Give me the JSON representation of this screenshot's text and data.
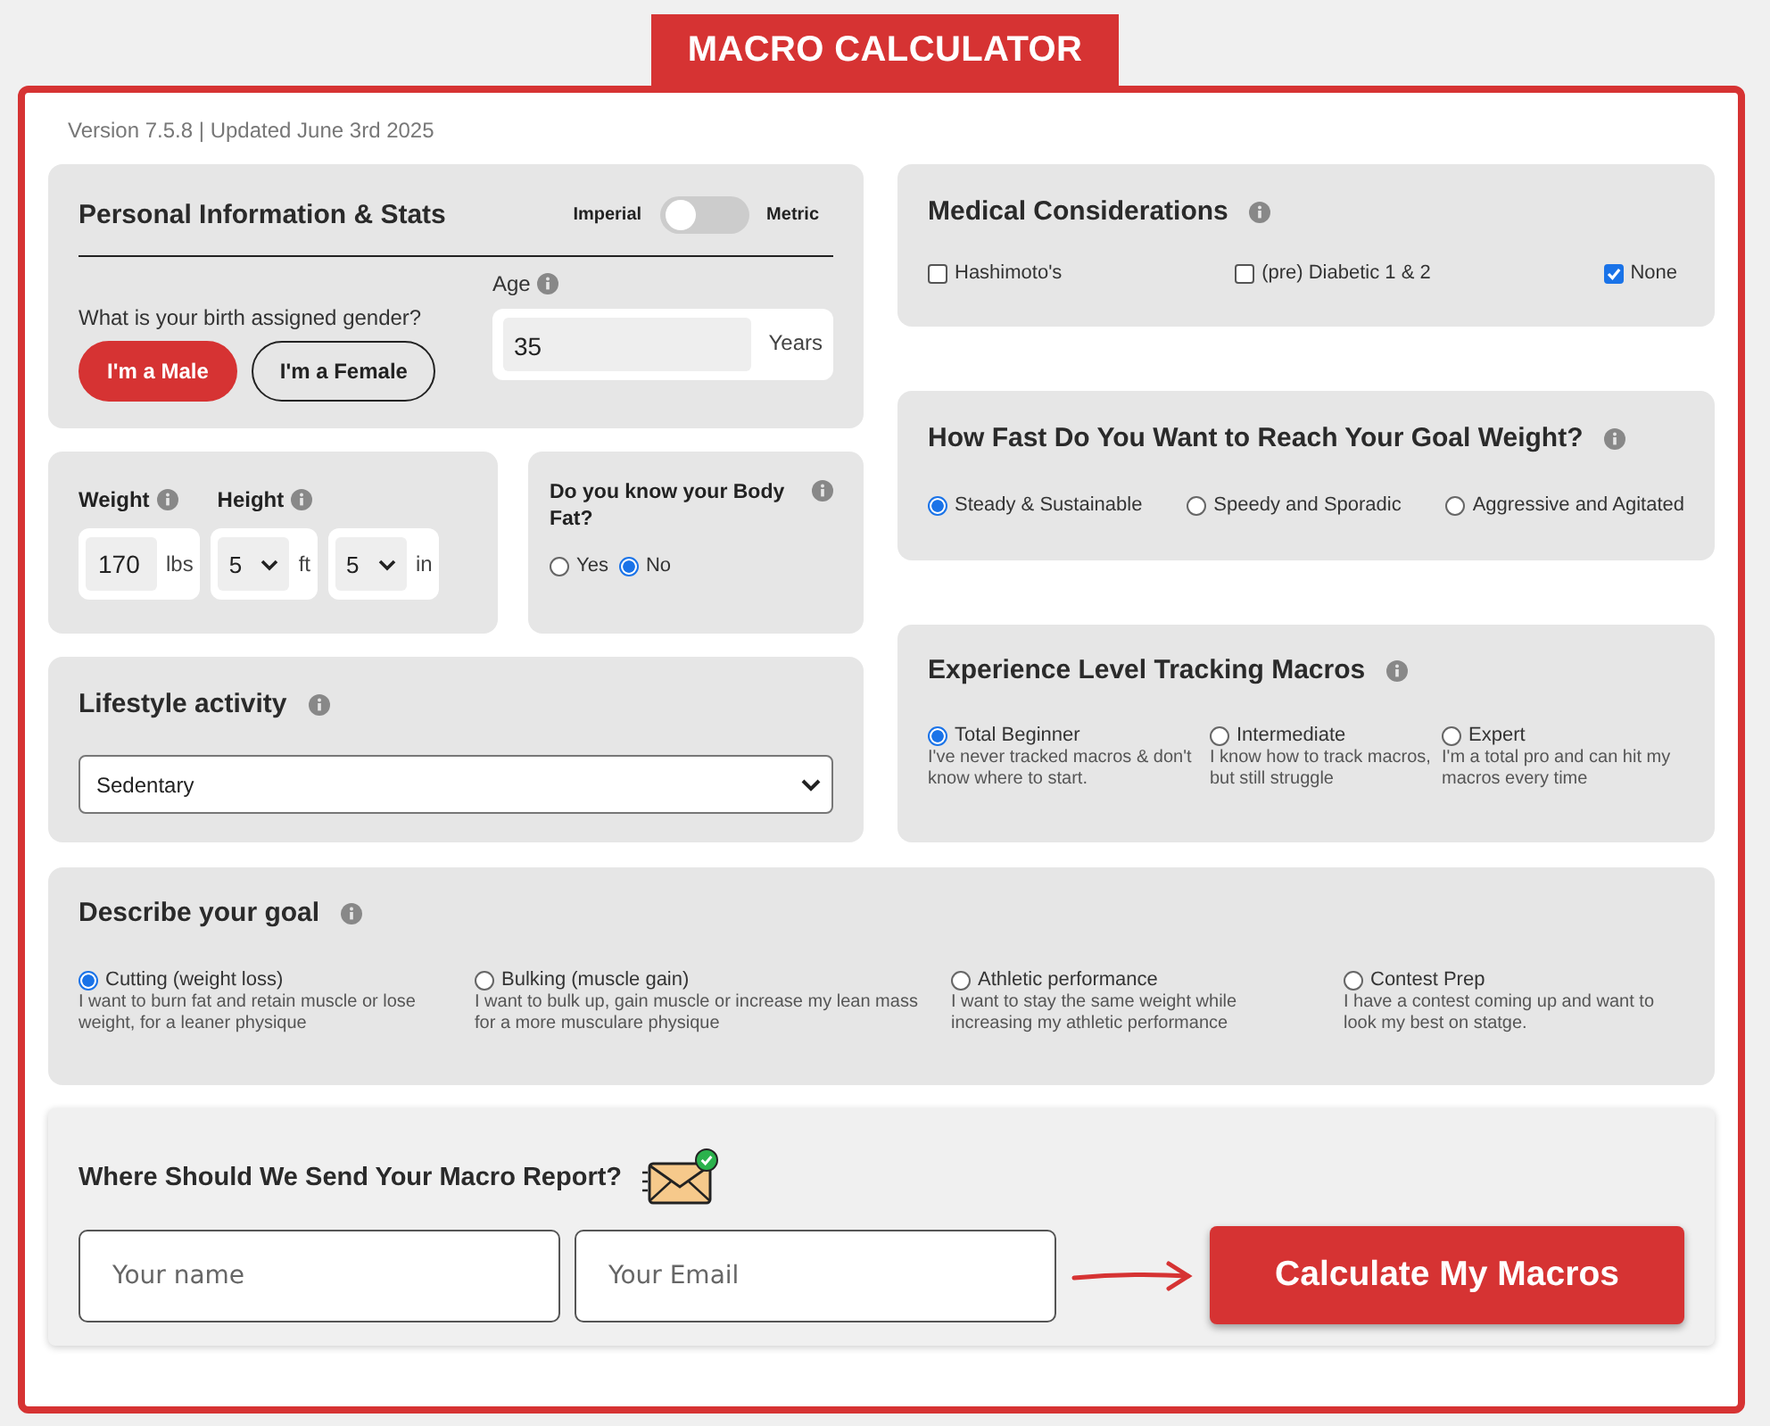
{
  "header": {
    "title": "MACRO CALCULATOR"
  },
  "version": "Version 7.5.8 | Updated June 3rd 2025",
  "personal": {
    "title": "Personal Information & Stats",
    "unit_toggle": {
      "left": "Imperial",
      "right": "Metric",
      "on": false
    },
    "gender": {
      "question": "What is your birth assigned gender?",
      "options": [
        {
          "label": "I'm a Male",
          "selected": true
        },
        {
          "label": "I'm a Female",
          "selected": false
        }
      ]
    },
    "age": {
      "label": "Age",
      "value": "35",
      "unit": "Years"
    }
  },
  "measurements": {
    "weight_label": "Weight",
    "height_label": "Height",
    "fields": [
      {
        "kind": "input",
        "value": "170",
        "unit": "lbs"
      },
      {
        "kind": "select",
        "value": "5",
        "unit": "ft"
      },
      {
        "kind": "select",
        "value": "5",
        "unit": "in"
      }
    ]
  },
  "body_fat": {
    "question": "Do you know your Body Fat?",
    "options": [
      {
        "label": "Yes",
        "selected": false
      },
      {
        "label": "No",
        "selected": true
      }
    ]
  },
  "lifestyle": {
    "title": "Lifestyle activity",
    "value": "Sedentary"
  },
  "medical": {
    "title": "Medical Considerations",
    "options": [
      {
        "label": "Hashimoto's",
        "checked": false
      },
      {
        "label": "(pre) Diabetic 1 & 2",
        "checked": false
      },
      {
        "label": "None",
        "checked": true
      }
    ]
  },
  "speed": {
    "title": "How Fast Do You Want to Reach Your Goal Weight?",
    "options": [
      {
        "label": "Steady & Sustainable",
        "selected": true
      },
      {
        "label": "Speedy and Sporadic",
        "selected": false
      },
      {
        "label": "Aggressive and Agitated",
        "selected": false
      }
    ]
  },
  "experience": {
    "title": "Experience Level Tracking Macros",
    "options": [
      {
        "label": "Total Beginner",
        "description": "I've never tracked macros & don't know where to start.",
        "selected": true
      },
      {
        "label": "Intermediate",
        "description": "I know how to track macros, but still struggle",
        "selected": false
      },
      {
        "label": "Expert",
        "description": "I'm a total pro and can hit my macros every time",
        "selected": false
      }
    ]
  },
  "goal": {
    "title": "Describe your goal",
    "options": [
      {
        "label": "Cutting (weight loss)",
        "description": "I want to burn fat and retain muscle or lose weight, for a leaner physique",
        "selected": true
      },
      {
        "label": "Bulking (muscle gain)",
        "description": "I want to bulk up, gain muscle or increase my lean mass for a more musculare physique",
        "selected": false
      },
      {
        "label": "Athletic performance",
        "description": "I want to stay the same weight while increasing my athletic performance",
        "selected": false
      },
      {
        "label": "Contest Prep",
        "description": "I have a contest coming up and want to look my best on statge.",
        "selected": false
      }
    ]
  },
  "report": {
    "title": "Where Should We Send Your Macro Report?",
    "name_placeholder": "Your name",
    "email_placeholder": "Your Email",
    "button": "Calculate My Macros"
  }
}
